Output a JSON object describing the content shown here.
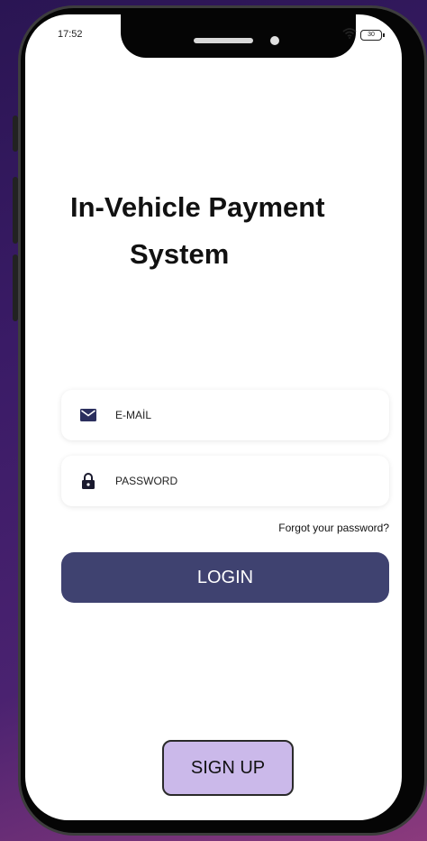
{
  "status_bar": {
    "time": "17:52",
    "battery": "30"
  },
  "title": {
    "line1": "In-Vehicle Payment",
    "line2": "System"
  },
  "form": {
    "email_placeholder": "E-MAİL",
    "password_placeholder": "PASSWORD",
    "forgot_link": "Forgot your password?",
    "login_label": "LOGIN",
    "signup_label": "SIGN UP"
  },
  "icons": {
    "email": "envelope-icon",
    "password": "lock-icon",
    "wifi": "wifi-icon",
    "battery": "battery-icon"
  },
  "colors": {
    "primary": "#3f4270",
    "signup_bg": "#cbb9ea",
    "icon": "#2b2f5e"
  }
}
